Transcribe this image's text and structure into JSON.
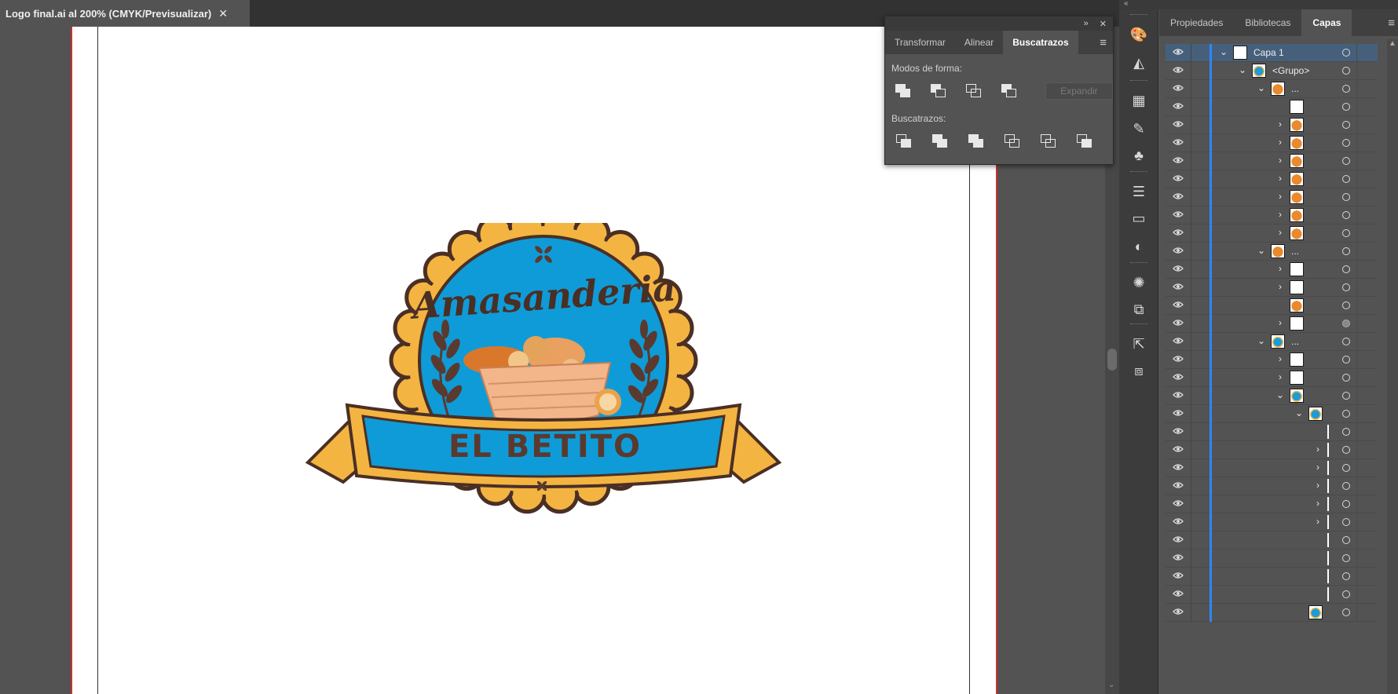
{
  "document": {
    "tab_title": "Logo final.ai al 200% (CMYK/Previsualizar)",
    "close_glyph": "✕"
  },
  "logo": {
    "script_text": "Amasanderia",
    "banner_text": "EL BETITO",
    "colors": {
      "blue": "#0f9bd7",
      "gold": "#f4b441",
      "brown": "#5a3a2e",
      "outline": "#4a2f25"
    }
  },
  "pathfinder": {
    "tabs": [
      "Transformar",
      "Alinear",
      "Buscatrazos"
    ],
    "active_tab": "Buscatrazos",
    "shape_modes_label": "Modos de forma:",
    "pathfinders_label": "Buscatrazos:",
    "expand_label": "Expandir"
  },
  "dock": {
    "tabs": [
      "Propiedades",
      "Bibliotecas",
      "Capas"
    ],
    "active_tab": "Capas",
    "strip_icons": [
      "color-guide-icon",
      "gradient-panel-icon",
      "swatches-icon",
      "brushes-icon",
      "symbols-icon",
      "stroke-icon",
      "gradient-icon",
      "transparency-icon",
      "appearance-icon",
      "graphic-styles-icon",
      "export-icon",
      "artboards-icon"
    ]
  },
  "layers": {
    "rows": [
      {
        "indent": 0,
        "chevron": "down",
        "thumb": "white",
        "name": "Capa 1",
        "selected": true
      },
      {
        "indent": 1,
        "chevron": "down",
        "thumb": "blue",
        "name": "<Grupo>"
      },
      {
        "indent": 2,
        "chevron": "down",
        "thumb": "orange",
        "name": "..."
      },
      {
        "indent": 3,
        "chevron": "",
        "thumb": "white",
        "name": ""
      },
      {
        "indent": 3,
        "chevron": "right",
        "thumb": "orange",
        "name": ""
      },
      {
        "indent": 3,
        "chevron": "right",
        "thumb": "orange",
        "name": ""
      },
      {
        "indent": 3,
        "chevron": "right",
        "thumb": "orange",
        "name": ""
      },
      {
        "indent": 3,
        "chevron": "right",
        "thumb": "orange",
        "name": ""
      },
      {
        "indent": 3,
        "chevron": "right",
        "thumb": "orange",
        "name": ""
      },
      {
        "indent": 3,
        "chevron": "right",
        "thumb": "orange",
        "name": ""
      },
      {
        "indent": 3,
        "chevron": "right",
        "thumb": "orange",
        "name": ""
      },
      {
        "indent": 2,
        "chevron": "down",
        "thumb": "orange",
        "name": "..."
      },
      {
        "indent": 3,
        "chevron": "right",
        "thumb": "white",
        "name": ""
      },
      {
        "indent": 3,
        "chevron": "right",
        "thumb": "white",
        "name": ""
      },
      {
        "indent": 3,
        "chevron": "",
        "thumb": "orange",
        "name": ""
      },
      {
        "indent": 3,
        "chevron": "right",
        "thumb": "white",
        "name": "",
        "filled_target": true
      },
      {
        "indent": 2,
        "chevron": "down",
        "thumb": "blue",
        "name": "..."
      },
      {
        "indent": 3,
        "chevron": "right",
        "thumb": "x",
        "name": ""
      },
      {
        "indent": 3,
        "chevron": "right",
        "thumb": "x",
        "name": ""
      },
      {
        "indent": 3,
        "chevron": "down",
        "thumb": "blue",
        "name": ""
      },
      {
        "indent": 4,
        "chevron": "down",
        "thumb": "blue",
        "name": ""
      },
      {
        "indent": 5,
        "chevron": "",
        "thumb": "tick",
        "name": ""
      },
      {
        "indent": 5,
        "chevron": "right",
        "thumb": "tick",
        "name": ""
      },
      {
        "indent": 5,
        "chevron": "right",
        "thumb": "tick",
        "name": ""
      },
      {
        "indent": 5,
        "chevron": "right",
        "thumb": "tick",
        "name": ""
      },
      {
        "indent": 5,
        "chevron": "right",
        "thumb": "tick",
        "name": ""
      },
      {
        "indent": 5,
        "chevron": "right",
        "thumb": "tick",
        "name": ""
      },
      {
        "indent": 5,
        "chevron": "",
        "thumb": "tick",
        "name": ""
      },
      {
        "indent": 5,
        "chevron": "",
        "thumb": "tick",
        "name": ""
      },
      {
        "indent": 5,
        "chevron": "",
        "thumb": "tick",
        "name": ""
      },
      {
        "indent": 5,
        "chevron": "",
        "thumb": "tick",
        "name": ""
      },
      {
        "indent": 4,
        "chevron": "",
        "thumb": "blue",
        "name": ""
      }
    ]
  }
}
